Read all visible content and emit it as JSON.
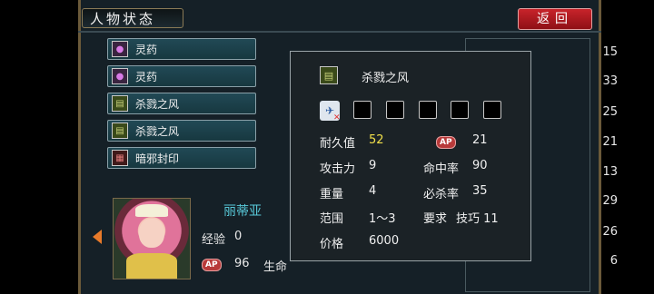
{
  "header": {
    "title": "人物状态",
    "back_label": "返回"
  },
  "items": [
    {
      "name": "灵药",
      "icon": "potion-icon"
    },
    {
      "name": "灵药",
      "icon": "potion-icon"
    },
    {
      "name": "杀戮之风",
      "icon": "book-icon"
    },
    {
      "name": "杀戮之风",
      "icon": "book-icon"
    },
    {
      "name": "暗邪封印",
      "icon": "seal-icon"
    }
  ],
  "right_column_values": [
    "15",
    "33",
    "25",
    "21",
    "13",
    "29",
    "26",
    "6"
  ],
  "character": {
    "name": "丽蒂亚",
    "exp_label": "经验",
    "exp_value": "0",
    "ap_badge": "AP",
    "ap_value": "96",
    "hp_label": "生命"
  },
  "detail_popup": {
    "item_name": "杀戮之风",
    "durability_label": "耐久值",
    "durability_value": "52",
    "ap_badge": "AP",
    "ap_value": "21",
    "attack_label": "攻击力",
    "attack_value": "9",
    "hit_label": "命中率",
    "hit_value": "90",
    "weight_label": "重量",
    "weight_value": "4",
    "crit_label": "必杀率",
    "crit_value": "35",
    "range_label": "范围",
    "range_value": "1～3",
    "req_label": "要求",
    "req_value": "技巧 11",
    "price_label": "价格",
    "price_value": "6000",
    "gem_slots": 5
  },
  "colors": {
    "accent_red": "#c8232a",
    "highlight_yellow": "#f2e04a",
    "name_cyan": "#58c8d8"
  }
}
